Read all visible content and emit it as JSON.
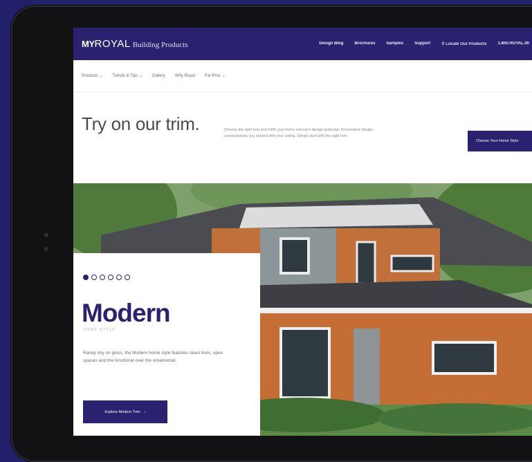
{
  "brand": {
    "mark": "MY",
    "name": "ROYAL",
    "tagline": "Building Products"
  },
  "topnav": [
    "Design Blog",
    "Brochures",
    "Samples",
    "Support",
    "Locate Our Products",
    "1.800.ROYAL.00"
  ],
  "subnav": [
    "Products",
    "Trends & Tips",
    "Gallery",
    "Why Royal",
    "For Pros"
  ],
  "intro": {
    "heading": "Try on our trim.",
    "body": "Choose the right trim and fulfill your home exterior's design potential. Personalize design conversations you started with your siding. Simply start with the right trim.",
    "cta": "Choose Your Home Style"
  },
  "hero": {
    "slide_count": 6,
    "active_slide": 1,
    "title": "Modern",
    "subtitle": "HOME STYLE",
    "description": "Rarely shy on gloss, the Modern home style features clean lines, open spaces and the functional over the ornamental.",
    "button": "Explore Modern Trim"
  },
  "icons": {
    "location": "location-pin-icon",
    "chevron": "chevron-down-icon",
    "arrow": "arrow-right-icon"
  },
  "colors": {
    "brand": "#2a2270",
    "background": "#221f6b"
  }
}
